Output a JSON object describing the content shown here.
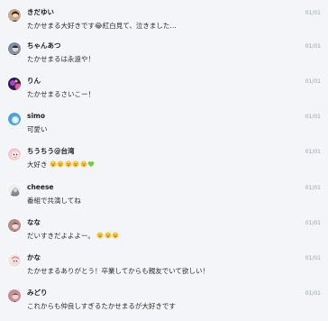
{
  "comments": [
    {
      "name": "きだゆい",
      "time": "01/01",
      "text": "たかせまる大好きです😂紅白見て、泣きました…"
    },
    {
      "name": "ちゃんあつ",
      "time": "01/01",
      "text": "たかせまるは永遠や！"
    },
    {
      "name": "りん",
      "time": "01/01",
      "text": "たかせまるさいこー！"
    },
    {
      "name": "simo",
      "time": "01/01",
      "text": "可愛い"
    },
    {
      "name": "ちうちう@台湾",
      "time": "01/01",
      "text": "大好き"
    },
    {
      "name": "cheese",
      "time": "01/01",
      "text": "番組で共演してね"
    },
    {
      "name": "なな",
      "time": "01/01",
      "text": "だいすきだよよよー。"
    },
    {
      "name": "かな",
      "time": "01/01",
      "text": "たかせまるありがとう！卒業してからも親友でいて欲しい！"
    },
    {
      "name": "みどり",
      "time": "01/01",
      "text": "これからも仲良しすぎるたかせまるが大好きです"
    }
  ],
  "colors": {
    "background": "#f3f5f8",
    "time": "#9aa3ad",
    "emoji_face": "#f7c948",
    "heart": "#6fcf3a"
  }
}
